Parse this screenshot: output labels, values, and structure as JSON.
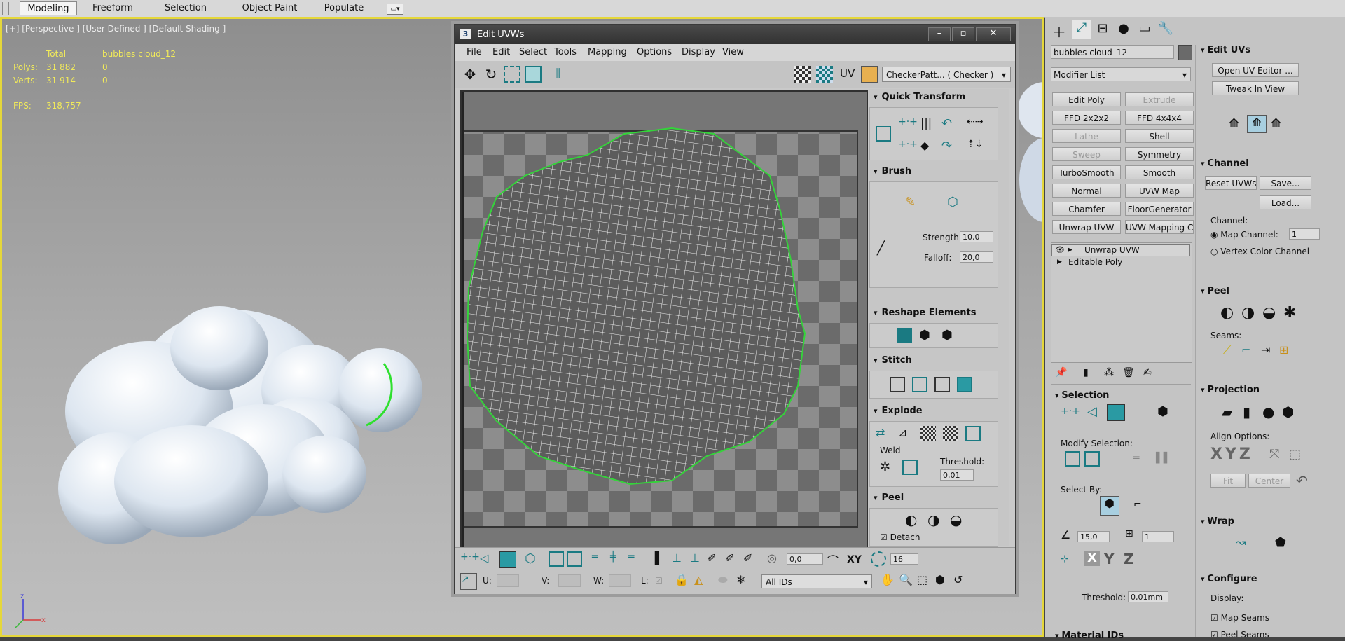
{
  "ribbon": {
    "tabs": [
      "Modeling",
      "Freeform",
      "Selection",
      "Object Paint",
      "Populate"
    ]
  },
  "viewport": {
    "label": "[+] [Perspective ] [User Defined ] [Default Shading ]",
    "stats": {
      "col_total": "Total",
      "col_object": "bubbles cloud_12",
      "polys_label": "Polys:",
      "polys_total": "31 882",
      "polys_obj": "0",
      "verts_label": "Verts:",
      "verts_total": "31 914",
      "verts_obj": "0",
      "fps_label": "FPS:",
      "fps_value": "318,757"
    }
  },
  "uvw": {
    "title": "Edit UVWs",
    "title_icon": "3",
    "menu": [
      "File",
      "Edit",
      "Select",
      "Tools",
      "Mapping",
      "Options",
      "Display",
      "View"
    ],
    "uv_label": "UV",
    "texture_dropdown": "CheckerPatt... ( Checker )",
    "rollouts": {
      "quick_transform": "Quick Transform",
      "brush": "Brush",
      "strength_label": "Strength:",
      "strength_value": "10,0",
      "falloff_label": "Falloff:",
      "falloff_value": "20,0",
      "reshape": "Reshape Elements",
      "stitch": "Stitch",
      "explode": "Explode",
      "weld_label": "Weld",
      "threshold_label": "Threshold:",
      "threshold_value": "0,01",
      "peel": "Peel",
      "detach_label": "Detach"
    },
    "bottom": {
      "soft_value": "0,0",
      "xy_label": "XY",
      "grid_value": "16",
      "u_label": "U:",
      "v_label": "V:",
      "w_label": "W:",
      "l_label": "L:",
      "ids_dropdown": "All IDs"
    }
  },
  "cmd": {
    "object_name": "bubbles cloud_12",
    "modifier_list": "Modifier List",
    "modifier_buttons": [
      {
        "label": "Edit Poly",
        "enabled": true
      },
      {
        "label": "Extrude",
        "enabled": false
      },
      {
        "label": "FFD 2x2x2",
        "enabled": true
      },
      {
        "label": "FFD 4x4x4",
        "enabled": true
      },
      {
        "label": "Lathe",
        "enabled": false
      },
      {
        "label": "Shell",
        "enabled": true
      },
      {
        "label": "Sweep",
        "enabled": false
      },
      {
        "label": "Symmetry",
        "enabled": true
      },
      {
        "label": "TurboSmooth",
        "enabled": true
      },
      {
        "label": "Smooth",
        "enabled": true
      },
      {
        "label": "Normal",
        "enabled": true
      },
      {
        "label": "UVW Map",
        "enabled": true
      },
      {
        "label": "Chamfer",
        "enabled": true
      },
      {
        "label": "FloorGenerator",
        "enabled": true
      },
      {
        "label": "Unwrap UVW",
        "enabled": true
      },
      {
        "label": "UVW Mapping Clea",
        "enabled": true
      }
    ],
    "stack": [
      "Unwrap UVW",
      "Editable Poly"
    ],
    "selection": {
      "title": "Selection",
      "modify_label": "Modify Selection:",
      "select_by_label": "Select By:",
      "angle_value": "15,0",
      "loop_value": "1",
      "threshold_label": "Threshold:",
      "threshold_value": "0,01mm",
      "next_title": "Material IDs"
    },
    "edit_uvs": {
      "title": "Edit UVs",
      "open_btn": "Open UV Editor ...",
      "tweak_btn": "Tweak In View"
    },
    "channel": {
      "title": "Channel",
      "reset_btn": "Reset UVWs",
      "save_btn": "Save...",
      "load_btn": "Load...",
      "channel_label": "Channel:",
      "map_channel_label": "Map Channel:",
      "map_channel_value": "1",
      "vertex_color_label": "Vertex Color Channel"
    },
    "peel": {
      "title": "Peel",
      "seams_label": "Seams:"
    },
    "projection": {
      "title": "Projection",
      "align_label": "Align Options:",
      "fit_btn": "Fit",
      "center_btn": "Center"
    },
    "wrap": {
      "title": "Wrap"
    },
    "configure": {
      "title": "Configure",
      "display_label": "Display:",
      "map_seams": "Map Seams",
      "peel_seams": "Peel Seams"
    }
  }
}
